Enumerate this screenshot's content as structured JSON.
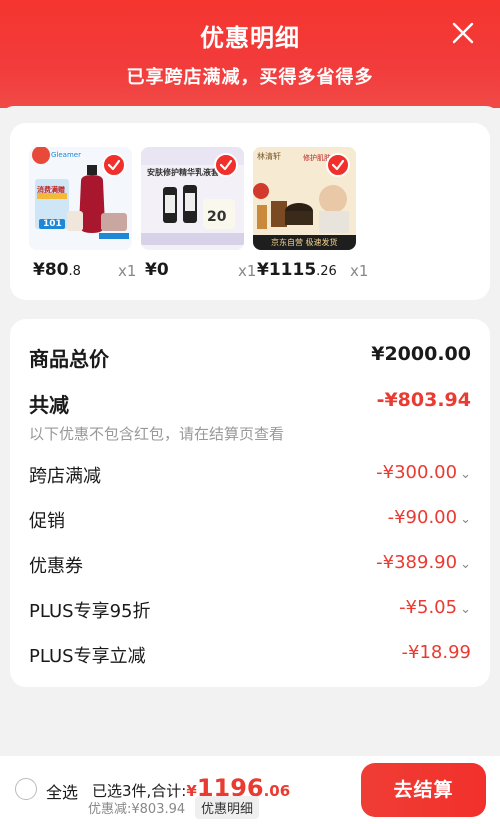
{
  "header": {
    "title": "优惠明细",
    "subtitle": "已享跨店满减，买得多省得多",
    "close_icon": "close-icon"
  },
  "products": [
    {
      "price_int": "¥80",
      "price_dec": ".8",
      "qty": "x1",
      "thumb_colors": [
        "#cfe6f6",
        "#a8172e"
      ]
    },
    {
      "price_int": "¥0",
      "price_dec": "",
      "qty": "x1",
      "thumb_colors": [
        "#f1eef9",
        "#1f1f1f"
      ]
    },
    {
      "price_int": "¥1115",
      "price_dec": ".26",
      "qty": "x1",
      "thumb_colors": [
        "#f3e7cc",
        "#2b1f14"
      ]
    }
  ],
  "thumb_text": {
    "p1_brand": "Gleamer",
    "p1_label": "消费满赠",
    "p1_num": "101",
    "p2_title": "安肤修护精华乳液套",
    "p2_num": "20",
    "p3_tag": "修护肌肤",
    "p3_brand": "林清轩",
    "p3_foot": "京东自营 极速发货"
  },
  "summary": {
    "total_label": "商品总价",
    "total_value": "¥2000.00",
    "reduce_label": "共减",
    "reduce_value": "-¥803.94",
    "note": "以下优惠不包含红包，请在结算页查看",
    "items": [
      {
        "label": "跨店满减",
        "value": "-¥300.00",
        "has_chevron": true
      },
      {
        "label": "促销",
        "value": "-¥90.00",
        "has_chevron": true
      },
      {
        "label": "优惠券",
        "value": "-¥389.90",
        "has_chevron": true
      },
      {
        "label": "PLUS专享95折",
        "value": "-¥5.05",
        "has_chevron": true
      },
      {
        "label": "PLUS专享立减",
        "value": "-¥18.99",
        "has_chevron": false
      }
    ],
    "chevron": "⌄"
  },
  "footer": {
    "select_all": "全选",
    "selected_text": "已选3件,合计:",
    "amount_symbol": "¥",
    "amount_int": "1196",
    "amount_dec": ".06",
    "discount_text": "优惠减:¥803.94",
    "detail_button": "优惠明细",
    "checkout_button": "去结算"
  },
  "colors": {
    "brand_red": "#f23b3b",
    "price_red": "#e93b32",
    "background": "#f2f2f2"
  }
}
